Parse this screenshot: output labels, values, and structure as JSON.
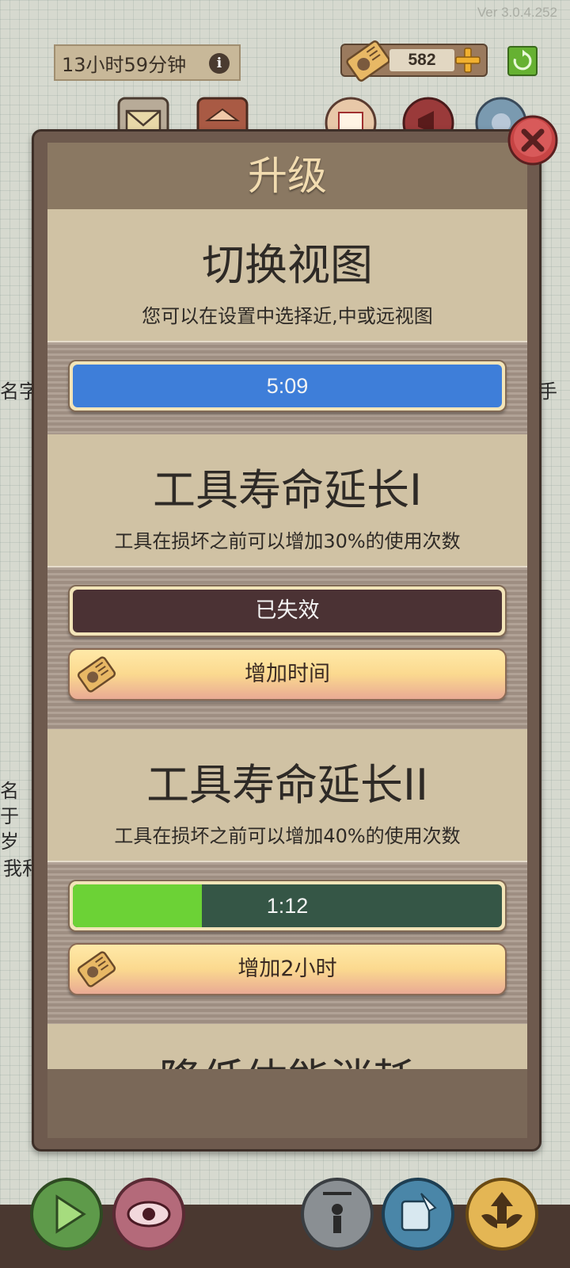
{
  "header": {
    "version": "Ver 3.0.4.252",
    "timer": "13小时59分钟",
    "info_glyph": "i",
    "currency_amount": "582"
  },
  "background_text": {
    "left_mid": "名字",
    "right_mid": "手",
    "left_lower": [
      "名",
      "于",
      "岁",
      "我和"
    ]
  },
  "dialog": {
    "title": "升级",
    "cards": [
      {
        "title": "切换视图",
        "desc": "您可以在设置中选择近,中或远视图",
        "bar_label": "5:09",
        "bar_progress": 1.0
      },
      {
        "title": "工具寿命延长I",
        "desc": "工具在损坏之前可以增加30%的使用次数",
        "bar_label": "已失效",
        "button_label": "增加时间"
      },
      {
        "title": "工具寿命延长II",
        "desc": "工具在损坏之前可以增加40%的使用次数",
        "bar_label": "1:12",
        "bar_progress": 0.3,
        "button_label": "增加2小时"
      },
      {
        "title": "降低体能消耗"
      }
    ]
  },
  "icons": {
    "ticket": "ticket-icon",
    "plus": "plus-icon",
    "refresh": "refresh-icon",
    "mail": "mail-icon",
    "shop": "shop-icon",
    "calendar": "calendar-icon",
    "megaphone": "megaphone-icon",
    "settings": "gear-icon",
    "close": "close-icon",
    "play": "play-icon",
    "eye": "eye-icon",
    "puppet": "puppet-icon",
    "scroll": "scroll-quill-icon",
    "upgrade": "winged-arrow-icon"
  },
  "colors": {
    "progress_blue": "#3e7ed9",
    "progress_green": "#6cd236",
    "expired_maroon": "#4b3234",
    "title_gold": "#f2dcb0"
  }
}
